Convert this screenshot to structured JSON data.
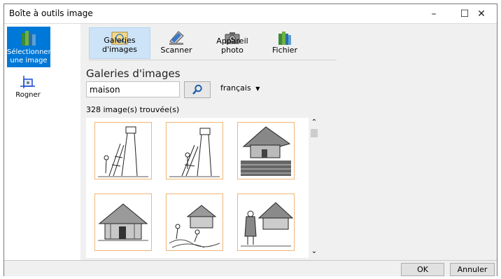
{
  "window": {
    "title": "Boîte à outils image",
    "controls": [
      "–",
      "☐",
      "✕"
    ]
  },
  "left_panel": {
    "items": [
      {
        "label": "Sélectionner une image",
        "icon": "books-icon",
        "selected": true
      },
      {
        "label": "Rogner",
        "icon": "crop-icon",
        "selected": false
      }
    ]
  },
  "tabs": [
    {
      "label": "Galeries d'images",
      "icon": "gallery-icon",
      "selected": true
    },
    {
      "label": "Scanner",
      "icon": "scanner-icon",
      "selected": false
    },
    {
      "label": "Appareil photo",
      "icon": "camera-icon",
      "selected": false
    },
    {
      "label": "Fichier",
      "icon": "books-icon",
      "selected": false
    }
  ],
  "gallery": {
    "heading": "Galeries d'images",
    "search_value": "maison",
    "language": "français",
    "result_count": "328 image(s) trouvée(s)",
    "thumbnails": [
      {
        "icon": "ladder-tower-drawing"
      },
      {
        "icon": "ladder-tower-drawing"
      },
      {
        "icon": "thatched-house-garden-drawing"
      },
      {
        "icon": "wooden-house-drawing"
      },
      {
        "icon": "house-people-drawing"
      },
      {
        "icon": "house-woman-drawing"
      }
    ]
  },
  "buttons": {
    "ok": "OK",
    "cancel": "Annuler"
  }
}
